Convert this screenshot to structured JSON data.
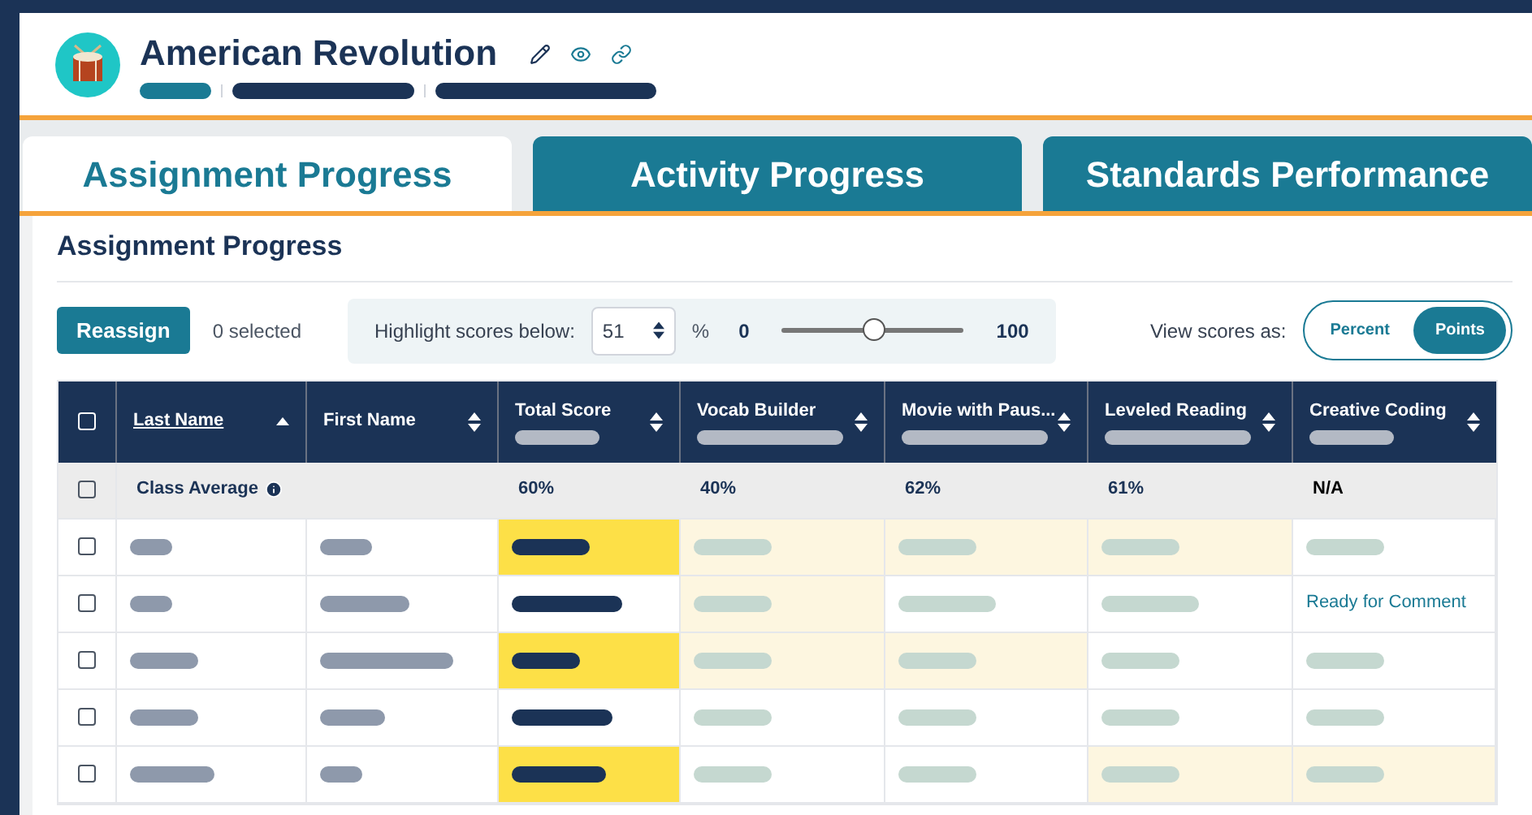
{
  "header": {
    "title": "American Revolution"
  },
  "tabs": [
    {
      "label": "Assignment Progress",
      "selected": true
    },
    {
      "label": "Activity Progress",
      "selected": false
    },
    {
      "label": "Standards Performance",
      "selected": false
    }
  ],
  "section_title": "Assignment Progress",
  "toolbar": {
    "reassign": "Reassign",
    "selected_count": "0 selected",
    "highlight_label": "Highlight scores below:",
    "highlight_value": "51",
    "percent_sign": "%",
    "slider_min": "0",
    "slider_max": "100",
    "slider": {
      "level": 0.51
    },
    "view_label": "View scores as:",
    "view_options": [
      {
        "label": "Percent",
        "selected": false
      },
      {
        "label": "Points",
        "selected": true
      }
    ]
  },
  "table": {
    "header_checked": false,
    "columns": [
      {
        "label": "Last Name",
        "sorted": true,
        "subtitle_redacted": false
      },
      {
        "label": "First Name",
        "sorted": false,
        "subtitle_redacted": false
      },
      {
        "label": "Total Score",
        "sorted": false,
        "subtitle_redacted": true
      },
      {
        "label": "Vocab Builder",
        "sorted": false,
        "subtitle_redacted": true
      },
      {
        "label": "Movie with Paus...",
        "sorted": false,
        "subtitle_redacted": true
      },
      {
        "label": "Leveled Reading",
        "sorted": false,
        "subtitle_redacted": true
      },
      {
        "label": "Creative Coding",
        "sorted": false,
        "subtitle_redacted": true
      }
    ],
    "average": {
      "label": "Class Average",
      "checked": false,
      "values": [
        "60%",
        "40%",
        "62%",
        "61%",
        "N/A"
      ]
    },
    "rows": [
      {
        "checked": false,
        "cells": [
          {
            "kind": "redacted",
            "highlighted": false
          },
          {
            "kind": "redacted",
            "highlighted": false
          },
          {
            "kind": "redacted",
            "highlighted": true
          },
          {
            "kind": "redacted",
            "highlighted": true
          },
          {
            "kind": "redacted",
            "highlighted": true
          },
          {
            "kind": "redacted",
            "highlighted": true
          },
          {
            "kind": "redacted",
            "highlighted": false
          }
        ]
      },
      {
        "checked": false,
        "cells": [
          {
            "kind": "redacted",
            "highlighted": false
          },
          {
            "kind": "redacted",
            "highlighted": false
          },
          {
            "kind": "redacted",
            "highlighted": false
          },
          {
            "kind": "redacted",
            "highlighted": true
          },
          {
            "kind": "redacted",
            "highlighted": false
          },
          {
            "kind": "redacted",
            "highlighted": false
          },
          {
            "kind": "text",
            "text": "Ready for Comment",
            "highlighted": false
          }
        ]
      },
      {
        "checked": false,
        "cells": [
          {
            "kind": "redacted",
            "highlighted": false
          },
          {
            "kind": "redacted",
            "highlighted": false
          },
          {
            "kind": "redacted",
            "highlighted": true
          },
          {
            "kind": "redacted",
            "highlighted": true
          },
          {
            "kind": "redacted",
            "highlighted": true
          },
          {
            "kind": "redacted",
            "highlighted": false
          },
          {
            "kind": "redacted",
            "highlighted": false
          }
        ]
      },
      {
        "checked": false,
        "cells": [
          {
            "kind": "redacted",
            "highlighted": false
          },
          {
            "kind": "redacted",
            "highlighted": false
          },
          {
            "kind": "redacted",
            "highlighted": false
          },
          {
            "kind": "redacted",
            "highlighted": false
          },
          {
            "kind": "redacted",
            "highlighted": false
          },
          {
            "kind": "redacted",
            "highlighted": false
          },
          {
            "kind": "redacted",
            "highlighted": false
          }
        ]
      },
      {
        "checked": false,
        "cells": [
          {
            "kind": "redacted",
            "highlighted": false
          },
          {
            "kind": "redacted",
            "highlighted": false
          },
          {
            "kind": "redacted",
            "highlighted": true
          },
          {
            "kind": "redacted",
            "highlighted": false
          },
          {
            "kind": "redacted",
            "highlighted": false
          },
          {
            "kind": "redacted",
            "highlighted": true
          },
          {
            "kind": "redacted",
            "highlighted": true
          }
        ]
      }
    ]
  }
}
